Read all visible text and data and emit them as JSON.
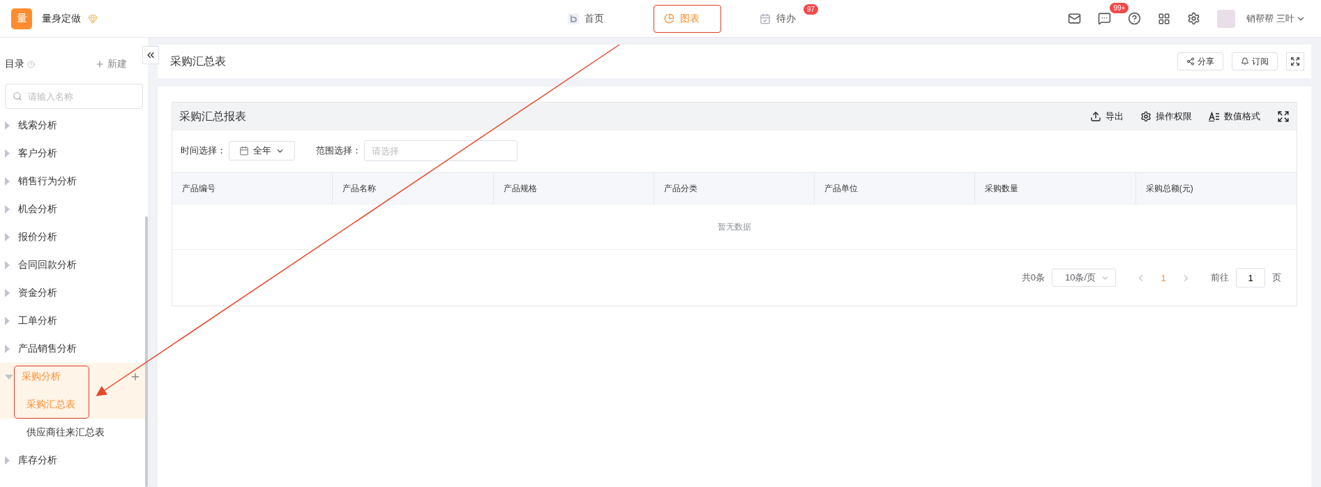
{
  "brand": {
    "logo": "量",
    "name": "量身定做"
  },
  "nav_tabs": [
    {
      "label": "首页",
      "selected": false,
      "highlighted": false
    },
    {
      "label": "图表",
      "selected": true,
      "highlighted": true
    },
    {
      "label": "待办",
      "selected": false,
      "highlighted": false,
      "badge": "97"
    }
  ],
  "toolbar": {
    "chat_badge": "99+",
    "user_name": "销帮帮 三叶"
  },
  "sidebar": {
    "title": "目录",
    "new_label": "新建",
    "search": {
      "placeholder": "请输入名称"
    },
    "items": [
      {
        "label": "线索分析",
        "expanded": false
      },
      {
        "label": "客户分析",
        "expanded": false
      },
      {
        "label": "销售行为分析",
        "expanded": false
      },
      {
        "label": "机会分析",
        "expanded": false
      },
      {
        "label": "报价分析",
        "expanded": false
      },
      {
        "label": "合同回款分析",
        "expanded": false
      },
      {
        "label": "资金分析",
        "expanded": false
      },
      {
        "label": "工单分析",
        "expanded": false
      },
      {
        "label": "产品销售分析",
        "expanded": false
      },
      {
        "label": "采购分析",
        "expanded": true,
        "highlighted": true,
        "children": [
          {
            "label": "采购汇总表",
            "selected": true
          },
          {
            "label": "供应商往来汇总表",
            "selected": false
          }
        ]
      },
      {
        "label": "库存分析",
        "expanded": false
      }
    ]
  },
  "page": {
    "title": "采购汇总表",
    "buttons": [
      "分享",
      "订阅"
    ]
  },
  "report": {
    "title": "采购汇总报表",
    "actions": [
      "导出",
      "操作权限",
      "数值格式"
    ],
    "filters": [
      {
        "kind": "select",
        "label": "时间选择：",
        "value": "全年"
      },
      {
        "kind": "input",
        "label": "范围选择：",
        "placeholder": "请选择"
      }
    ],
    "table": {
      "columns": [
        "产品编号",
        "产品名称",
        "产品规格",
        "产品分类",
        "产品单位",
        "采购数量",
        "采购总额(元)"
      ],
      "empty_text": "暂无数据"
    },
    "pagination": {
      "total": "共0条",
      "page_size": "10条/页",
      "pages": [
        {
          "label": "1",
          "selected": true
        }
      ],
      "goto_label": "前往",
      "goto_value": "1",
      "page_suffix": "页"
    }
  }
}
